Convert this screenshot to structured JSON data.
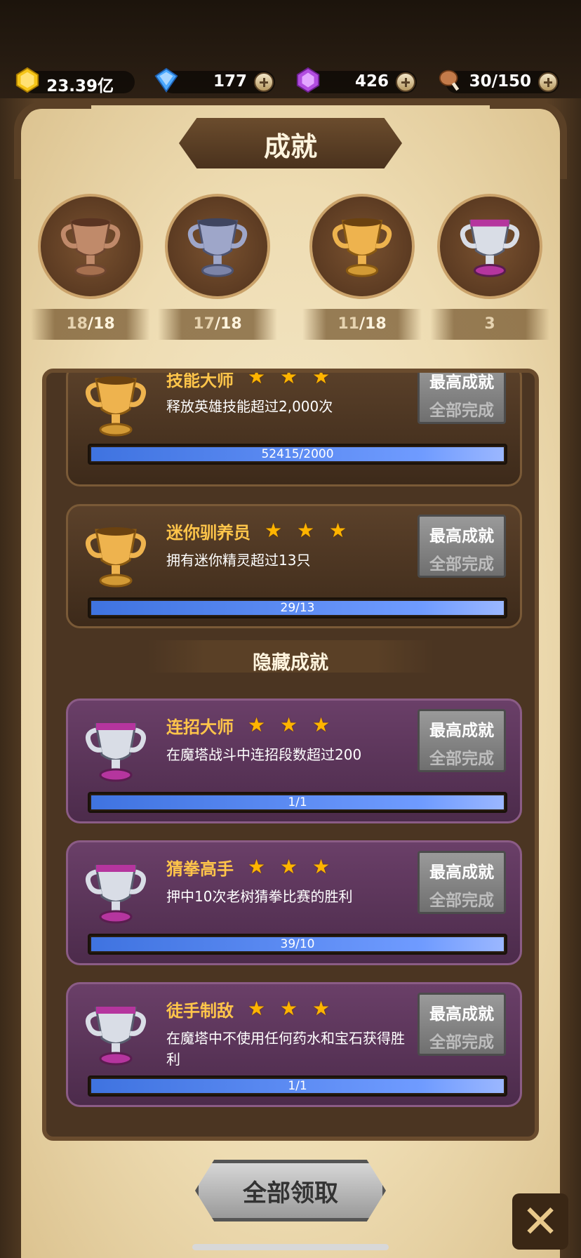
{
  "resources": [
    {
      "name": "gold",
      "value": "23.39亿",
      "icon": "gold-gem-icon",
      "color": "#f5c518"
    },
    {
      "name": "diamond",
      "value": "177",
      "icon": "blue-diamond-icon",
      "color": "#4aa8ff"
    },
    {
      "name": "crystal",
      "value": "426",
      "icon": "purple-crystal-icon",
      "color": "#b24de0"
    },
    {
      "name": "stamina",
      "value": "30/150",
      "icon": "meat-icon",
      "color": "#c47b4a"
    }
  ],
  "title": "成就",
  "medals": [
    {
      "icon": "bronze-trophy-icon",
      "progress": "18",
      "total": "18"
    },
    {
      "icon": "silver-trophy-icon",
      "progress": "17",
      "total": "18"
    },
    {
      "icon": "gold-trophy-icon",
      "progress": "11",
      "total": "18"
    },
    {
      "icon": "purple-trophy-icon",
      "count": "3"
    }
  ],
  "achievements": [
    {
      "name": "技能大师",
      "desc": "释放英雄技能超过2,000次",
      "stars": "★ ★ ★",
      "button_top": "最高成就",
      "button_bottom": "全部完成",
      "progress": "52415/2000",
      "fill": 1.0,
      "type": "gold"
    },
    {
      "name": "迷你驯养员",
      "desc": "拥有迷你精灵超过13只",
      "stars": "★ ★ ★",
      "button_top": "最高成就",
      "button_bottom": "全部完成",
      "progress": "29/13",
      "fill": 1.0,
      "type": "gold"
    }
  ],
  "hidden_section_title": "隐藏成就",
  "hidden_achievements": [
    {
      "name": "连招大师",
      "desc": "在魔塔战斗中连招段数超过200",
      "stars": "★ ★ ★",
      "button_top": "最高成就",
      "button_bottom": "全部完成",
      "progress": "1/1",
      "fill": 1.0,
      "type": "purple"
    },
    {
      "name": "猜拳高手",
      "desc": "押中10次老树猜拳比赛的胜利",
      "stars": "★ ★ ★",
      "button_top": "最高成就",
      "button_bottom": "全部完成",
      "progress": "39/10",
      "fill": 1.0,
      "type": "purple"
    },
    {
      "name": "徒手制敌",
      "desc": "在魔塔中不使用任何药水和宝石获得胜利",
      "stars": "★ ★ ★",
      "button_top": "最高成就",
      "button_bottom": "全部完成",
      "progress": "1/1",
      "fill": 1.0,
      "type": "purple"
    }
  ],
  "claim_all_label": "全部领取",
  "close_icon": "close-x-icon"
}
